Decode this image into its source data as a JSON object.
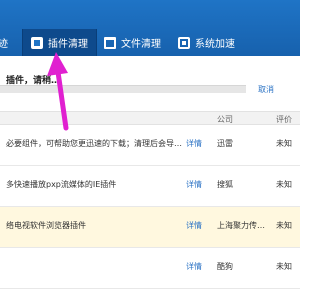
{
  "tabs": [
    {
      "label": "迹"
    },
    {
      "label": "插件清理"
    },
    {
      "label": "文件清理"
    },
    {
      "label": "系统加速"
    }
  ],
  "scan": {
    "status_text": "插件，请稍…",
    "cancel_label": "取消"
  },
  "table": {
    "headers": {
      "company": "公司",
      "rating": "评价"
    },
    "rows": [
      {
        "description": "必要组件，可帮助您更迅速的下载；清理后会导…",
        "detail": "详情",
        "company": "迅雷",
        "rating": "未知"
      },
      {
        "description": "多快速播放pxp流媒体的IE插件",
        "detail": "详情",
        "company": "搜狐",
        "rating": "未知"
      },
      {
        "description": "络电视软件浏览器插件",
        "detail": "详情",
        "company": "上海聚力传…",
        "rating": "未知"
      },
      {
        "description": "",
        "detail": "详情",
        "company": "酷狗",
        "rating": "未知"
      }
    ]
  },
  "colors": {
    "header_blue": "#1f74c6",
    "annotation_arrow": "#e020d0",
    "link_blue": "#2a72c4"
  }
}
